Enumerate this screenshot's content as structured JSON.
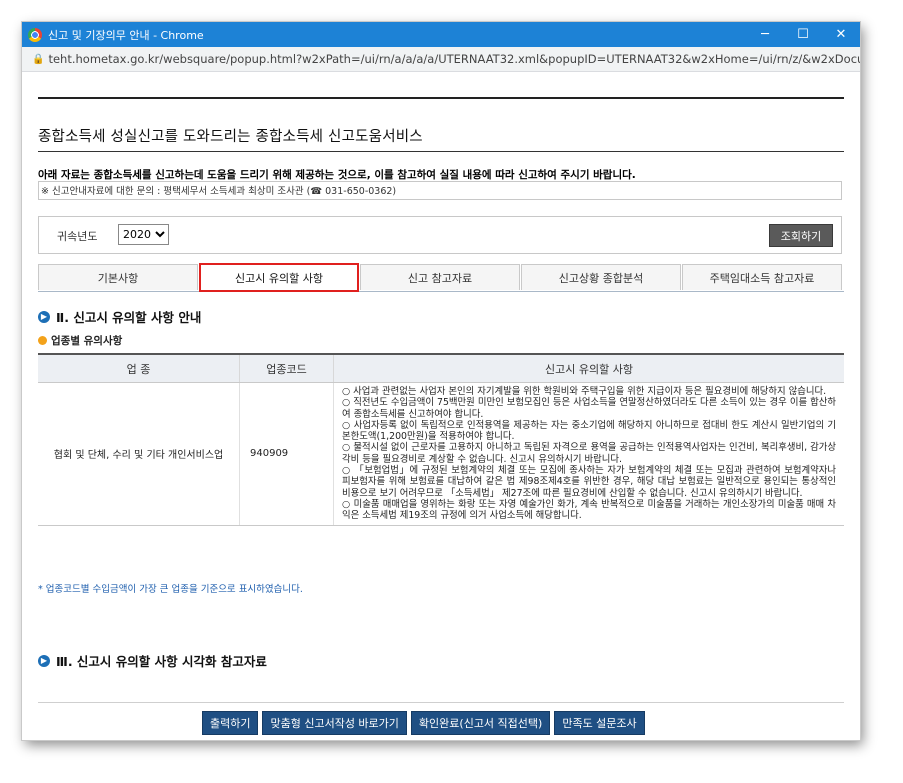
{
  "window": {
    "title": "신고 및 기장의무 안내 - Chrome",
    "url": "teht.hometax.go.kr/websquare/popup.html?w2xPath=/ui/rn/a/a/a/a/UTERNAAT32.xml&popupID=UTERNAAT32&w2xHome=/ui/rn/z/&w2xDocume...",
    "minimize": "─",
    "maximize": "☐",
    "close": "✕"
  },
  "page": {
    "heading": "종합소득세 성실신고를 도와드리는 종합소득세 신고도움서비스",
    "notice": "아래 자료는 종합소득세를 신고하는데 도움을 드리기 위해 제공하는 것으로, 이를 참고하여 실질 내용에 따라 신고하여 주시기 바랍니다.",
    "contact": "※ 신고안내자료에 대한 문의 : 평택세무서 소득세과 최상미 조사관 (☎ 031-650-0362)"
  },
  "filter": {
    "year_label": "귀속년도",
    "year_value": "2020",
    "query_button": "조회하기"
  },
  "tabs": [
    {
      "label": "기본사항"
    },
    {
      "label": "신고시 유의할 사항"
    },
    {
      "label": "신고 참고자료"
    },
    {
      "label": "신고상황 종합분석"
    },
    {
      "label": "주택임대소득 참고자료"
    }
  ],
  "section2": {
    "title": "Ⅱ. 신고시 유의할 사항 안내",
    "subtitle": "업종별 유의사항",
    "columns": [
      "업 종",
      "업종코드",
      "신고시 유의할 사항"
    ],
    "row": {
      "industry": "협회 및 단체, 수리 및 기타 개인서비스업",
      "code": "940909",
      "notes": [
        "○ 사업과 관련없는 사업자 본인의 자기계발을 위한 학원비와 주택구입을 위한 지급이자 등은 필요경비에 해당하지 않습니다.",
        "○ 직전년도 수입금액이 75백만원 미만인 보험모집인 등은 사업소득을 연말정산하였더라도 다른 소득이 있는 경우 이를 합산하여 종합소득세를 신고하여야 합니다.",
        "○ 사업자등록 없이 독립적으로 인적용역을 제공하는 자는 중소기업에 해당하지 아니하므로 접대비 한도 계산시 일반기업의 기본한도액(1,200만원)을 적용하여야 합니다.",
        "○ 물적시설 없이 근로자를 고용하지 아니하고 독립된 자격으로 용역을 공급하는 인적용역사업자는 인건비, 복리후생비, 감가상각비 등을 필요경비로 계상할 수 없습니다. 신고시 유의하시기 바랍니다.",
        "○ 「보험업법」에 규정된 보험계약의 체결 또는 모집에 종사하는 자가 보험계약의 체결 또는 모집과 관련하여 보험계약자나 피보험자를 위해 보험료를 대납하여 같은 법 제98조제4호를 위반한 경우, 해당 대납 보험료는 일반적으로 용인되는 통상적인 비용으로 보기 어려우므로 「소득세법」 제27조에 따른 필요경비에 산입할 수 없습니다. 신고시 유의하시기 바랍니다.",
        "○ 미술품 매매업을 영위하는 화랑 또는 자영 예술가인 화가, 계속 반복적으로 미술품을 거래하는 개인소장가의 미술품 매매 차익은 소득세법 제19조의 규정에 의거 사업소득에 해당합니다."
      ]
    },
    "footnote": "* 업종코드별 수입금액이 가장 큰 업종을 기준으로 표시하였습니다."
  },
  "section3": {
    "title": "Ⅲ. 신고시 유의할 사항 시각화 참고자료"
  },
  "buttons": {
    "print": "출력하기",
    "custom_form": "맞춤형 신고서작성 바로가기",
    "confirm": "확인완료(신고서 직접선택)",
    "survey": "만족도 설문조사"
  },
  "colors": {
    "titlebar": "#1d82d6",
    "active_tab_border": "#e0201e",
    "button": "#1f4f83",
    "section_bullet": "#1d6fb6",
    "sub_bullet": "#f3a21a"
  }
}
